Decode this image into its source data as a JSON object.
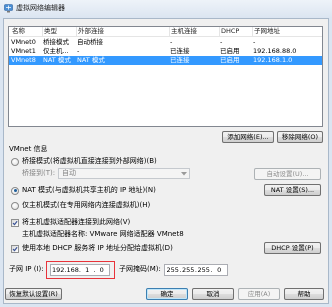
{
  "window": {
    "title": "虚拟网络编辑器"
  },
  "network_table": {
    "columns": [
      "名称",
      "类型",
      "外部连接",
      "主机连接",
      "DHCP",
      "子网地址"
    ],
    "rows": [
      {
        "name": "VMnet0",
        "type": "桥接模式",
        "external": "自动桥接",
        "host": "-",
        "dhcp": "-",
        "subnet": "-",
        "selected": false
      },
      {
        "name": "VMnet1",
        "type": "仅主机...",
        "external": "-",
        "host": "已连接",
        "dhcp": "已启用",
        "subnet": "192.168.88.0",
        "selected": false
      },
      {
        "name": "VMnet8",
        "type": "NAT 模式",
        "external": "NAT 模式",
        "host": "已连接",
        "dhcp": "已启用",
        "subnet": "192.168.1.0",
        "selected": true
      }
    ]
  },
  "table_actions": {
    "add_label": "添加网络(E)...",
    "remove_label": "移除网络(O)"
  },
  "vmnet_info": {
    "heading": "VMnet 信息",
    "bridged": {
      "label": "桥接模式(将虚拟机直接连接到外部网络)(B)",
      "checked": false
    },
    "bridged_to": {
      "label": "桥接到(T):",
      "value": "自动",
      "auto_settings_label": "自动设置(U)...",
      "disabled": true
    },
    "nat": {
      "label": "NAT 模式(与虚拟机共享主机的 IP 地址)(N)",
      "checked": true,
      "settings_label": "NAT 设置(S)..."
    },
    "host_only": {
      "label": "仅主机模式(在专用网络内连接虚拟机)(H)",
      "checked": false
    },
    "connect_adapter": {
      "label": "将主机虚拟适配器连接到此网络(V)",
      "checked": true
    },
    "adapter_name": "主机虚拟适配器名称: VMware 网络适配器 VMnet8",
    "dhcp": {
      "label": "使用本地 DHCP 服务将 IP 地址分配给虚拟机(D)",
      "checked": true,
      "settings_label": "DHCP 设置(P)"
    },
    "subnet_ip": {
      "label": "子网 IP (I):",
      "octets": [
        "192",
        "168",
        "1",
        "0"
      ],
      "highlighted": true
    },
    "subnet_mask": {
      "label": "子网掩码(M):",
      "octets": [
        "255",
        "255",
        "255",
        "0"
      ]
    }
  },
  "footer": {
    "restore": {
      "label": "恢复默认设置(R)"
    },
    "ok": {
      "label": "确定",
      "default": true
    },
    "cancel": {
      "label": "取消"
    },
    "apply": {
      "label": "应用(A)",
      "disabled": true
    },
    "help": {
      "label": "帮助"
    }
  },
  "icons": {
    "window": "network-editor-icon",
    "dropdown": "chevron-down-icon",
    "check": "checkmark-icon"
  },
  "colors": {
    "row_selection": "#3399ff",
    "annotation": "#e8333a",
    "dialog_bg": "#f0f0f0"
  }
}
